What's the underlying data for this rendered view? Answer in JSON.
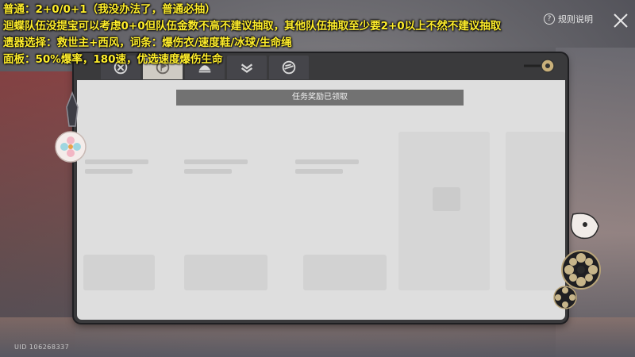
{
  "overlay": {
    "lines": [
      "普通：2+0/0+1（我没办法了，普通必抽）",
      "迴蝶队伍没提宝可以考虑0+0但队伍金数不高不建议抽取，其他队伍抽取至少要2+0以上不然不建议抽取",
      "遗器选择：救世主+西风，词条：爆伤衣/速度鞋/冰球/生命绳",
      "面板：50%爆率，180速，优选速度爆伤生命"
    ]
  },
  "header": {
    "rules_label": "规则说明"
  },
  "tabs": [
    {
      "icon": "emblem-icon",
      "active": false
    },
    {
      "icon": "flag-icon",
      "active": true
    },
    {
      "icon": "shell-icon",
      "active": false
    },
    {
      "icon": "chevron-stack-icon",
      "active": false
    },
    {
      "icon": "swirl-icon",
      "active": false
    }
  ],
  "banner": {
    "text": "任务奖励已领取"
  },
  "footer": {
    "uid": "UID 106268337"
  },
  "colors": {
    "overlay_text": "#ffee2b",
    "panel": "#dedede",
    "banner": "#727272"
  }
}
